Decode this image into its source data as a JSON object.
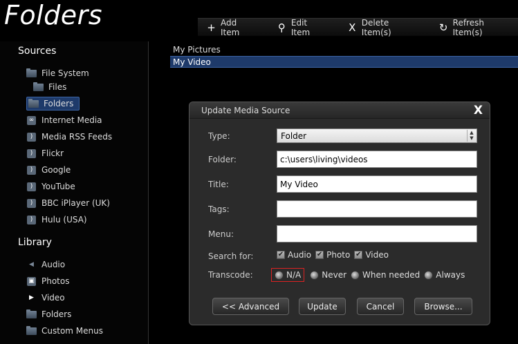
{
  "app": {
    "title": "Folders"
  },
  "toolbar": [
    {
      "name": "add-item-button",
      "icon": "plus-icon",
      "glyph": "+",
      "label": "Add Item"
    },
    {
      "name": "edit-item-button",
      "icon": "magnifier-icon",
      "glyph": "⚲",
      "label": "Edit Item"
    },
    {
      "name": "delete-items-button",
      "icon": "x-icon",
      "glyph": "X",
      "label": "Delete Item(s)"
    },
    {
      "name": "refresh-items-button",
      "icon": "refresh-icon",
      "glyph": "↻",
      "label": "Refresh Item(s)"
    }
  ],
  "sidebar": {
    "sources_heading": "Sources",
    "sources": [
      {
        "label": "File System",
        "icon": "folder-icon",
        "indent": 0
      },
      {
        "label": "Files",
        "icon": "folder-icon",
        "indent": 1
      },
      {
        "label": "Folders",
        "icon": "folder-icon",
        "indent": 1,
        "selected": true
      },
      {
        "label": "Internet Media",
        "icon": "internet-media-icon",
        "indent": 0
      },
      {
        "label": "Media RSS Feeds",
        "icon": "rss-icon",
        "indent": 0
      },
      {
        "label": "Flickr",
        "icon": "rss-icon",
        "indent": 0
      },
      {
        "label": "Google",
        "icon": "rss-icon",
        "indent": 0
      },
      {
        "label": "YouTube",
        "icon": "rss-icon",
        "indent": 0
      },
      {
        "label": "BBC iPlayer (UK)",
        "icon": "rss-icon",
        "indent": 0
      },
      {
        "label": "Hulu (USA)",
        "icon": "rss-icon",
        "indent": 0
      }
    ],
    "library_heading": "Library",
    "library": [
      {
        "label": "Audio",
        "icon": "speaker-icon"
      },
      {
        "label": "Photos",
        "icon": "photo-icon"
      },
      {
        "label": "Video",
        "icon": "video-icon"
      },
      {
        "label": "Folders",
        "icon": "folder-icon"
      },
      {
        "label": "Custom Menus",
        "icon": "folder-icon"
      }
    ]
  },
  "list": {
    "items": [
      {
        "label": "My Pictures",
        "selected": false
      },
      {
        "label": "My Video",
        "selected": true
      }
    ]
  },
  "dialog": {
    "title": "Update Media Source",
    "type_label": "Type:",
    "type_value": "Folder",
    "folder_label": "Folder:",
    "folder_value": "c:\\users\\living\\videos",
    "title_label": "Title:",
    "title_value": "My Video",
    "tags_label": "Tags:",
    "tags_value": "",
    "menu_label": "Menu:",
    "menu_value": "",
    "search_label": "Search for:",
    "search_options": [
      {
        "label": "Audio",
        "checked": true
      },
      {
        "label": "Photo",
        "checked": true
      },
      {
        "label": "Video",
        "checked": true
      }
    ],
    "transcode_label": "Transcode:",
    "transcode_options": [
      {
        "label": "N/A",
        "focused": true
      },
      {
        "label": "Never"
      },
      {
        "label": "When needed"
      },
      {
        "label": "Always"
      }
    ],
    "buttons": {
      "advanced": "<< Advanced",
      "update": "Update",
      "cancel": "Cancel",
      "browse": "Browse..."
    }
  }
}
